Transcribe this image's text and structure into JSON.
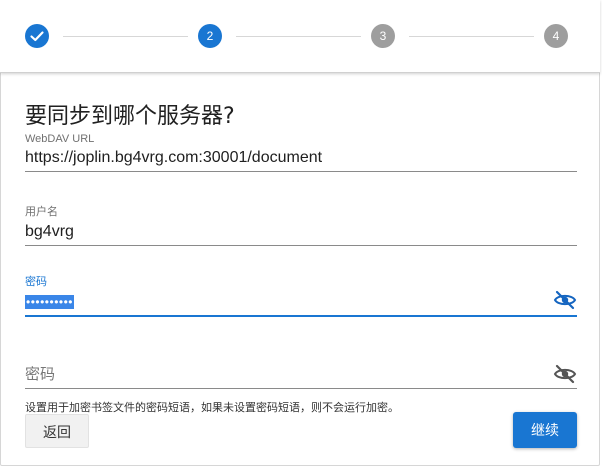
{
  "stepper": {
    "steps": [
      {
        "label": "",
        "state": "completed"
      },
      {
        "label": "2",
        "state": "active"
      },
      {
        "label": "3",
        "state": "inactive"
      },
      {
        "label": "4",
        "state": "inactive"
      }
    ]
  },
  "form": {
    "title": "要同步到哪个服务器?",
    "url_label": "WebDAV URL",
    "url_value": "https://joplin.bg4vrg.com:30001/document",
    "username_label": "用户名",
    "username_value": "bg4vrg",
    "password_label": "密码",
    "password_value": "••••••••••",
    "encryption_placeholder": "密码",
    "encryption_helper": "设置用于加密书签文件的密码短语，如果未设置密码短语，则不会运行加密。"
  },
  "buttons": {
    "back_label": "返回",
    "next_label": "继续"
  },
  "colors": {
    "accent": "#1976d2",
    "inactive_step": "#9e9e9e",
    "selection": "#3a86e8"
  }
}
